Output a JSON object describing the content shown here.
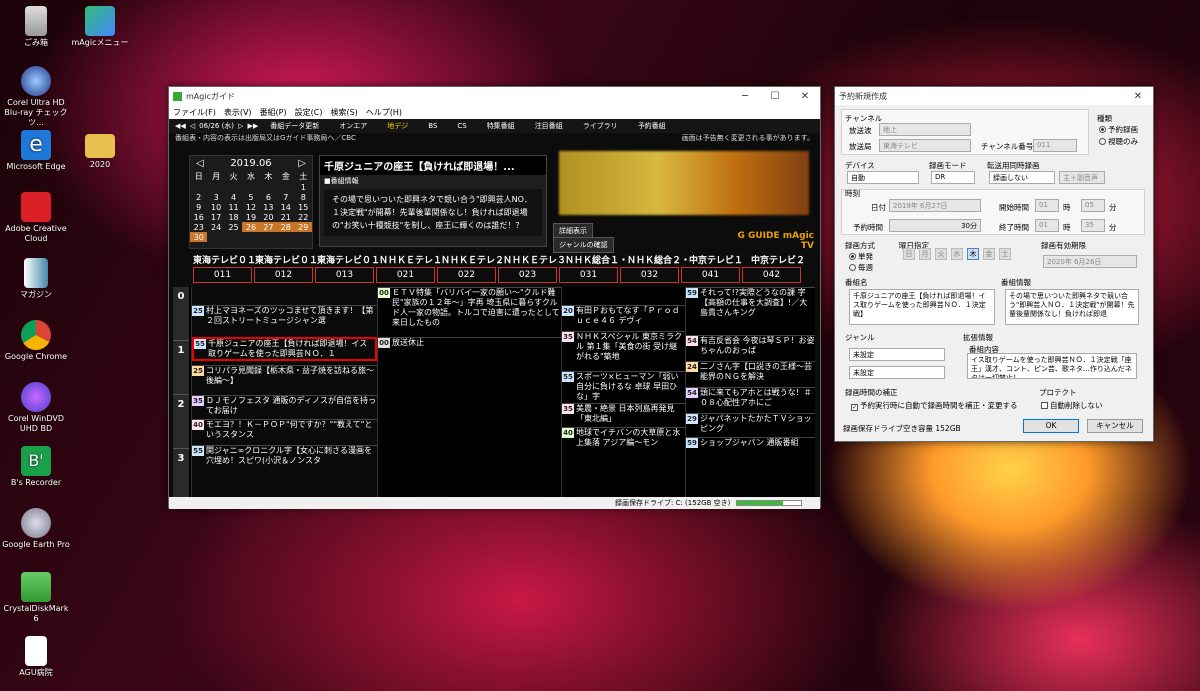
{
  "desktop": {
    "icons": [
      {
        "label": "ごみ箱"
      },
      {
        "label": "mAgicメニュー"
      },
      {
        "label": "Corel Ultra HD Blu-ray チェックツ..."
      },
      {
        "label": "Microsoft Edge"
      },
      {
        "label": "2020"
      },
      {
        "label": "Adobe Creative Cloud"
      },
      {
        "label": "マガジン"
      },
      {
        "label": "Google Chrome"
      },
      {
        "label": "Corel WinDVD UHD BD"
      },
      {
        "label": "B's Recorder"
      },
      {
        "label": "Google Earth Pro"
      },
      {
        "label": "CrystalDiskMark 6"
      },
      {
        "label": "AGU病院"
      }
    ]
  },
  "guide": {
    "title": "mAgicガイド",
    "menu": [
      "ファイル(F)",
      "表示(V)",
      "番組(P)",
      "設定(C)",
      "検索(S)",
      "ヘルプ(H)"
    ],
    "nav": {
      "date": "06/26 (水)",
      "prev": "前日",
      "next": "翌日",
      "tabs": [
        "番組データ更新",
        "オンエア",
        "地デジ",
        "BS",
        "CS",
        "特集番組",
        "注目番組",
        "ライブラリ",
        "予約番組"
      ]
    },
    "info_left": "番組表・内容の表示は出版局又はGガイド事務局へ／CBC",
    "info_right": "画面は予告無く変更される事があります。",
    "calendar": {
      "month": "2019.06",
      "weekdays": [
        "日",
        "月",
        "火",
        "水",
        "木",
        "金",
        "土"
      ],
      "weeks": [
        [
          "",
          "",
          "",
          "",
          "",
          "",
          "1"
        ],
        [
          "2",
          "3",
          "4",
          "5",
          "6",
          "7",
          "8"
        ],
        [
          "9",
          "10",
          "11",
          "12",
          "13",
          "14",
          "15"
        ],
        [
          "16",
          "17",
          "18",
          "19",
          "20",
          "21",
          "22"
        ],
        [
          "23",
          "24",
          "25",
          "26",
          "27",
          "28",
          "29"
        ],
        [
          "30",
          "",
          "",
          "",
          "",
          "",
          ""
        ]
      ]
    },
    "selected": {
      "title": "千原ジュニアの座王【負ければ即退場！...",
      "label": "■番組情報",
      "desc": "その場で思いついた即興ネタで競い合う\"即興芸人NO．１決定戦\"が開幕！先輩後輩関係なし！負ければ即退場の\"お笑い十種競技\"を制し、座王に輝くのは誰だ！？"
    },
    "btn_detail": "詳細表示",
    "btn_genre": "ジャンルの確認",
    "logo": "G GUIDE mAgic TV",
    "channels": [
      "東海テレビ０１",
      "東海テレビ０１",
      "東海テレビ０１",
      "ＮＨＫＥテレ１",
      "ＮＨＫＥテレ２",
      "ＮＨＫＥテレ３",
      "ＮＨＫ総合１・",
      "ＮＨＫ総合２・",
      "中京テレビ１",
      "中京テレビ２"
    ],
    "numbers": [
      "011",
      "012",
      "013",
      "021",
      "022",
      "023",
      "031",
      "032",
      "041",
      "042"
    ],
    "hours": [
      "0",
      "1",
      "2",
      "3"
    ],
    "col1": [
      {
        "m": "25",
        "t": "村上マヨネーズのツッコませて頂きます！【第２回ストリートミュージシャン選"
      },
      {
        "m": "55",
        "t": "千原ジュニアの座王【負ければ即退場！イス取りゲームを使った即興芸ＮＯ．１"
      },
      {
        "m": "25",
        "t": "コリパラ見聞録【栃木県・益子焼を訪ねる旅〜後編〜】"
      },
      {
        "m": "35",
        "t": "ＤＪモノフェスタ 通販のディノスが自信を持ってお届け"
      },
      {
        "m": "40",
        "t": "モエヨ？！Ｋ－ＰＯＰ\"何ですか？\"\"教えて\"というスタンス"
      },
      {
        "m": "55",
        "t": "関ジャニ∞クロニクル字【女心に刺さる漫画を穴埋め！スピワ(小沢＆ノンスタ"
      }
    ],
    "col2": [
      {
        "m": "00",
        "t": "ＥＴＶ特集「バリバイ一家の願い〜\"クルド難民\"家族の１２年〜」字再 埼玉県に暮らすクルド人一家の物語。トルコで迫害に遭ったとして来日したもの"
      },
      {
        "m": "00",
        "t": "放送休止"
      }
    ],
    "col3": [
      {
        "m": "20",
        "t": "有田Ｐおもてなす「Ｐｒｏｄｕｃｅ４６ デヴィ"
      },
      {
        "m": "35",
        "t": "ＮＨＫスペシャル 東京ミラクル 第１集「美食の街 受け継がれる\"築地"
      },
      {
        "m": "55",
        "t": "スポーツ×ヒューマン「弱い自分に負けるな 卓球 早田ひな」字"
      },
      {
        "m": "35",
        "t": "美農・絶景 日本列島再発見「東北編」"
      },
      {
        "m": "40",
        "t": "地球でイチバンの大草原と水上集落 アジア編〜モン"
      }
    ],
    "col4": [
      {
        "m": "59",
        "t": "それって!?実際どうなの課 字 【高額の仕事を大調査】!／大島貴さんキング"
      },
      {
        "m": "54",
        "t": "有吉反省会 今夜は琴ＳＰ！お姿ちゃんのおっぱ"
      },
      {
        "m": "24",
        "t": "二ノさん字【口説きの王様〜芸能界のＮＧを解決"
      },
      {
        "m": "54",
        "t": "頭に来てもアホとは戦うな！＃０８心配性アホにご"
      },
      {
        "m": "29",
        "t": "ジャパネットたかたＴＶショッピング"
      },
      {
        "m": "59",
        "t": "ショップジャパン 通販番組"
      }
    ],
    "status": "録画保存ドライブ: C: (152GB 空き)",
    "disk_free": 0.72
  },
  "dialog": {
    "title": "予約新規作成",
    "channel_grp": "チャンネル",
    "broadcast_lbl": "放送波",
    "broadcast": "地上",
    "station_lbl": "放送局",
    "station": "東海テレビ",
    "chno_lbl": "チャンネル番号",
    "chno": "011",
    "type_grp": "種類",
    "type_opts": [
      "予約録画",
      "視聴のみ"
    ],
    "device_lbl": "デバイス",
    "device": "自動",
    "mode_lbl": "録画モード",
    "mode": "DR",
    "transfer_lbl": "転送用同時録画",
    "transfer": "録画しない",
    "audio": "主＋副音声",
    "time_grp": "時刻",
    "date_lbl": "日付",
    "date": "2019年 6月27日",
    "start_lbl": "開始時間",
    "start_h": "01",
    "start_m": "05",
    "dur_lbl": "予約時間",
    "dur": "30分",
    "end_lbl": "終了時間",
    "end_h": "01",
    "end_m": "35",
    "hour_unit": "時",
    "min_unit": "分",
    "method_grp": "録画方式",
    "method_opts": [
      "単発",
      "毎週"
    ],
    "dow_grp": "曜日指定",
    "days": [
      "日",
      "月",
      "火",
      "水",
      "木",
      "金",
      "土"
    ],
    "expire_grp": "録画有効期限",
    "expire": "2020年 6月26日",
    "name_grp": "番組名",
    "name": "千原ジュニアの座王【負ければ即退場！イス取りゲームを使った即興芸ＮＯ．１決定戦】",
    "pinfo_grp": "番組情報",
    "pinfo": "その場で思いついた即興ネタで競い合う\"即興芸人ＮＯ．１決定戦\"が開幕！先輩後輩関係なし！負ければ即退",
    "genre_grp": "ジャンル",
    "genre1": "未設定",
    "genre2": "未設定",
    "ext_grp": "拡張情報",
    "ext_lbl": "番組内容",
    "ext": "イス取りゲームを使った即興芸ＮＯ．１決定戦「座王」漢才、コント、ピン芸、歌ネタ…作り込んだネタは一切禁止！",
    "fix_grp": "録画時間の補正",
    "fix": "予約実行時に自動で録画時間を補正・変更する",
    "protect_grp": "プロテクト",
    "protect": "自動削除しない",
    "free": "録画保存ドライブ空き容量 152GB",
    "ok": "OK",
    "cancel": "キャンセル"
  }
}
